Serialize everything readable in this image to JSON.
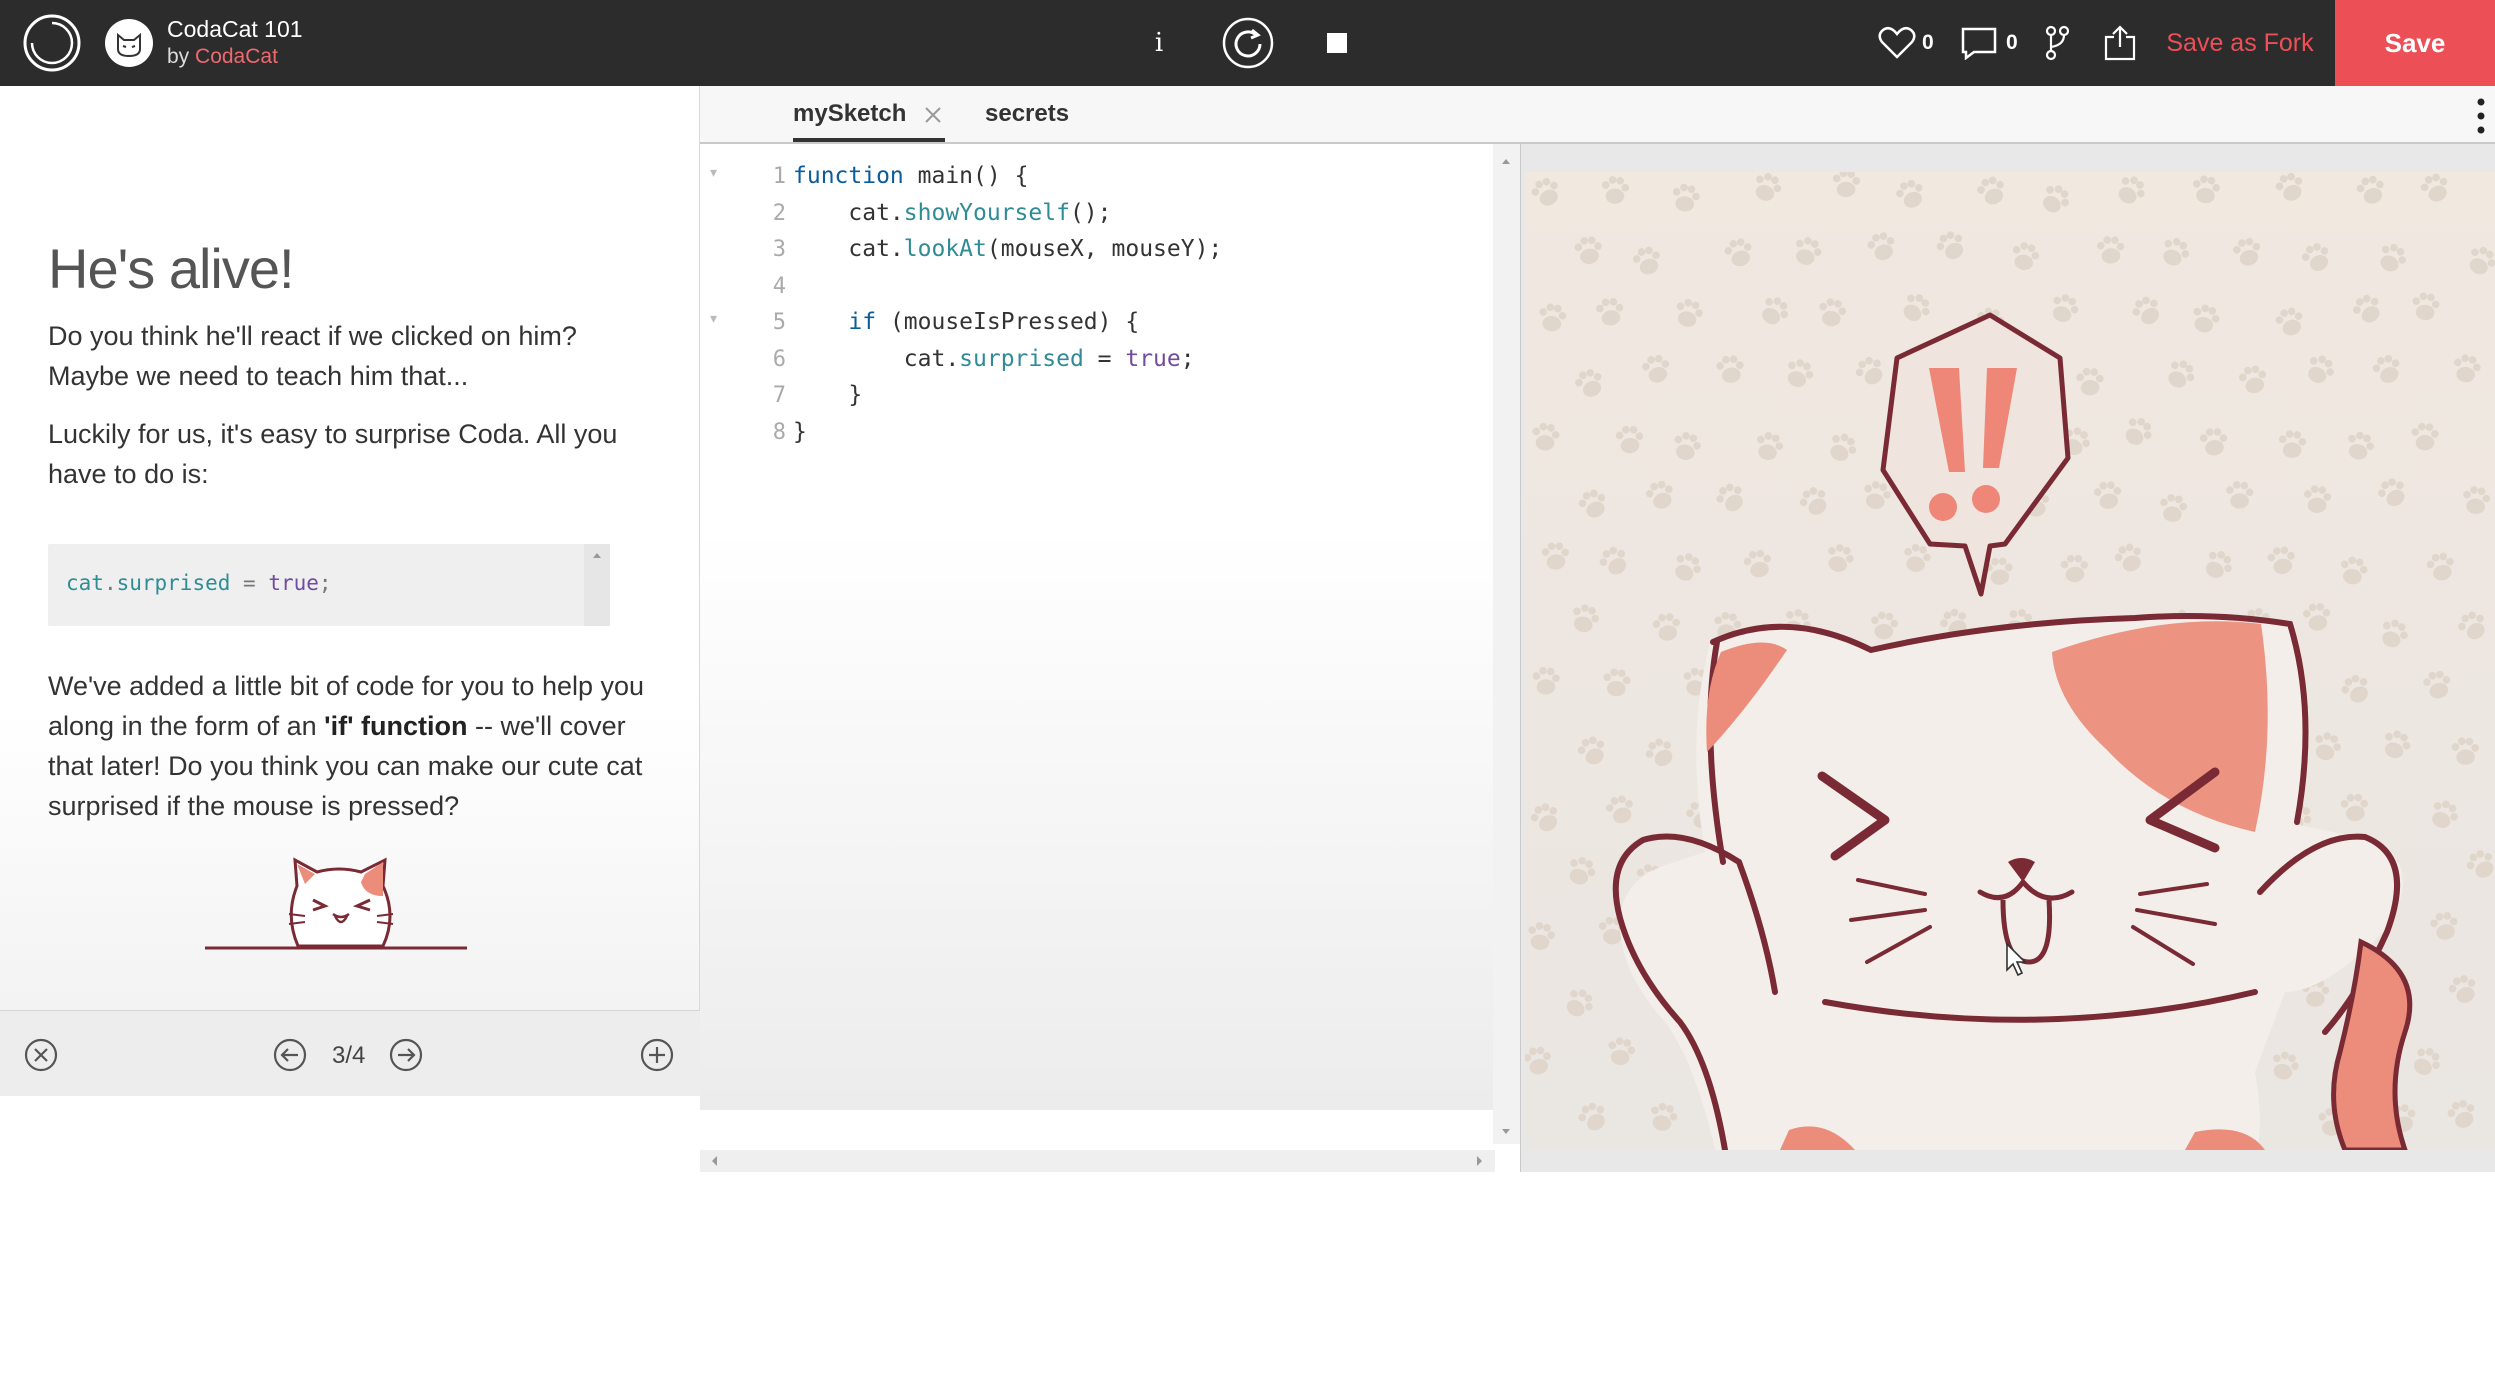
{
  "header": {
    "sketch_title": "CodaCat 101",
    "by_prefix": "by",
    "author": "CodaCat",
    "likes_count": "0",
    "comments_count": "0",
    "info_label": "i",
    "save_as_fork_label": "Save as Fork",
    "save_label": "Save",
    "icons": [
      "openprocessing-logo-icon",
      "avatar-cat-icon",
      "info-icon",
      "restart-icon",
      "stop-icon",
      "heart-icon",
      "comment-icon",
      "fork-icon",
      "share-icon"
    ],
    "colors": {
      "bar": "#2c2c2c",
      "accent": "#ed4f57",
      "author_link": "#ed6a6f"
    }
  },
  "tutorial": {
    "heading": "He's alive!",
    "p1": "Do you think he'll react if we clicked on him? Maybe we need to teach him that...",
    "p2": "Luckily for us, it's easy to surprise Coda. All you have to do is:",
    "snippet": {
      "obj": "cat",
      "dot": ".",
      "prop": "surprised",
      "op": " = ",
      "value": "true",
      "semi": ";"
    },
    "p3_a": "We've added a little bit of code for you to help you along in the form of an ",
    "p3_bold": "'if' function",
    "p3_b": " -- we'll cover that later! Do you think you can make our cute cat surprised if the mouse is pressed?",
    "footer": {
      "page": "3/4",
      "icons": [
        "close-circle-icon",
        "arrow-left-circle-icon",
        "arrow-right-circle-icon",
        "plus-circle-icon"
      ]
    }
  },
  "editor": {
    "tabs": [
      {
        "label": "mySketch",
        "active": true
      },
      {
        "label": "secrets",
        "active": false
      }
    ],
    "lines": [
      {
        "n": "1",
        "fold": "▾",
        "tokens": [
          [
            "kw",
            "function"
          ],
          [
            "p",
            " "
          ],
          [
            "plain",
            "main() {"
          ]
        ]
      },
      {
        "n": "2",
        "fold": "",
        "tokens": [
          [
            "p",
            "    "
          ],
          [
            "plain",
            "cat."
          ],
          [
            "fn",
            "showYourself"
          ],
          [
            "plain",
            "();"
          ]
        ]
      },
      {
        "n": "3",
        "fold": "",
        "tokens": [
          [
            "p",
            "    "
          ],
          [
            "plain",
            "cat."
          ],
          [
            "fn",
            "lookAt"
          ],
          [
            "plain",
            "(mouseX, mouseY);"
          ]
        ]
      },
      {
        "n": "4",
        "fold": "",
        "tokens": []
      },
      {
        "n": "5",
        "fold": "▾",
        "tokens": [
          [
            "p",
            "    "
          ],
          [
            "kw",
            "if"
          ],
          [
            "plain",
            " (mouseIsPressed) {"
          ]
        ]
      },
      {
        "n": "6",
        "fold": "",
        "tokens": [
          [
            "p",
            "        "
          ],
          [
            "plain",
            "cat."
          ],
          [
            "prop",
            "surprised"
          ],
          [
            "plain",
            " = "
          ],
          [
            "bool",
            "true"
          ],
          [
            "plain",
            ";"
          ]
        ]
      },
      {
        "n": "7",
        "fold": "",
        "tokens": [
          [
            "p",
            "    "
          ],
          [
            "plain",
            "}"
          ]
        ]
      },
      {
        "n": "8",
        "fold": "",
        "tokens": [
          [
            "plain",
            "}"
          ]
        ]
      }
    ],
    "syntax_colors": {
      "kw": "#0b5c9a",
      "fn": "#2f8c96",
      "prop": "#2f8c96",
      "bool": "#714c9e",
      "plain": "#333333"
    }
  },
  "canvas": {
    "scene": "surprised-cat-with-exclamation-bubble",
    "colors": {
      "background": "#f1e8e0",
      "paw": "#e0d6cc",
      "outline": "#7a2a34",
      "patch": "#ec8d7c",
      "bubble": "#ee8777"
    }
  }
}
